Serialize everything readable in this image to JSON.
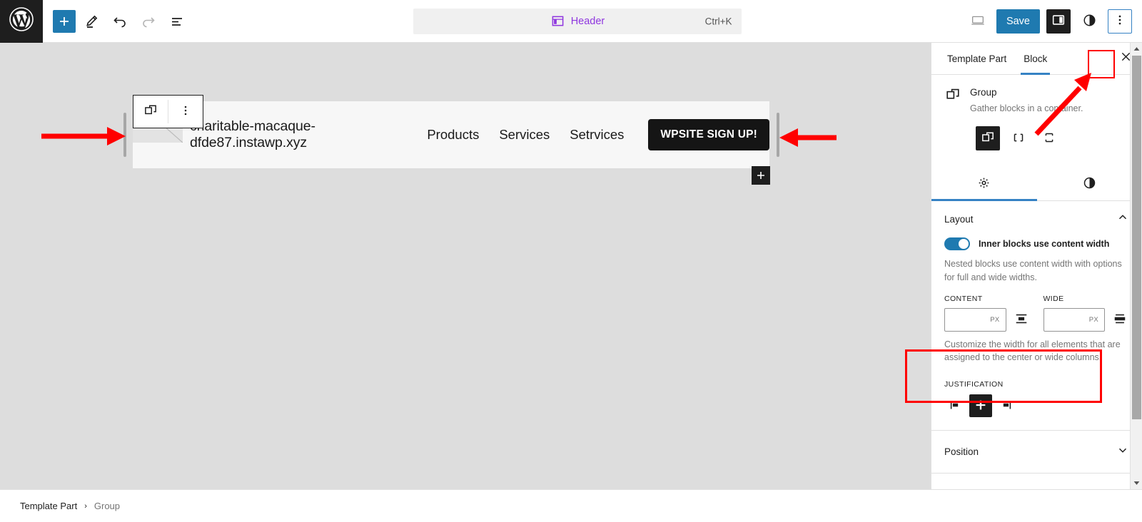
{
  "topbar": {
    "logo_icon": "wordpress-logo",
    "tools": [
      {
        "name": "add-block-button",
        "icon": "plus-icon",
        "label": "Add block"
      },
      {
        "name": "edit-tool-button",
        "icon": "pencil-icon",
        "label": "Tools"
      },
      {
        "name": "undo-button",
        "icon": "undo-icon",
        "label": "Undo"
      },
      {
        "name": "redo-button",
        "icon": "redo-icon",
        "label": "Redo"
      },
      {
        "name": "list-view-button",
        "icon": "list-view-icon",
        "label": "Document Overview"
      }
    ],
    "document_bar": {
      "icon": "template-part-icon",
      "title": "Header",
      "shortcut": "Ctrl+K"
    },
    "preview_label": "View",
    "save_label": "Save",
    "settings_toggle_label": "Settings",
    "styles_toggle_label": "Styles",
    "more_menu_label": "Options"
  },
  "canvas": {
    "block_toolbar": {
      "block_icon": "group-icon",
      "options_icon": "more-vertical-icon"
    },
    "site_logo_alt": "site-logo-placeholder",
    "site_title": "charitable-macaque-dfde87.instawp.xyz",
    "nav_links": [
      "Products",
      "Services",
      "Setrvices"
    ],
    "cta_label": "WPSITE SIGN UP!",
    "appender_label": "+"
  },
  "sidebar": {
    "tabs": [
      {
        "label": "Template Part",
        "active": false
      },
      {
        "label": "Block",
        "active": true
      }
    ],
    "close_label": "✕",
    "block": {
      "icon": "group-icon",
      "title": "Group",
      "description": "Gather blocks in a container."
    },
    "variations": [
      {
        "name": "variation-group",
        "icon": "group-icon",
        "active": true
      },
      {
        "name": "variation-row",
        "icon": "row-icon",
        "active": false
      },
      {
        "name": "variation-stack",
        "icon": "stack-icon",
        "active": false
      }
    ],
    "panel_tabs": [
      {
        "name": "settings-tab",
        "icon": "gear-icon",
        "active": true
      },
      {
        "name": "styles-tab",
        "icon": "contrast-icon",
        "active": false
      }
    ],
    "layout_panel": {
      "title": "Layout",
      "collapse_icon": "chevron-up-icon",
      "toggle_label": "Inner blocks use content width",
      "toggle_on": true,
      "help_text": "Nested blocks use content width with options for full and wide widths.",
      "content_label": "CONTENT",
      "content_value": "",
      "content_unit": "PX",
      "wide_label": "WIDE",
      "wide_value": "",
      "wide_unit": "PX",
      "width_help_text": "Customize the width for all elements that are assigned to the center or wide columns.",
      "justification_label": "JUSTIFICATION",
      "justification_options": [
        {
          "name": "justify-left-button",
          "active": false
        },
        {
          "name": "justify-center-button",
          "active": true
        },
        {
          "name": "justify-right-button",
          "active": false
        }
      ]
    },
    "position_panel": {
      "title": "Position",
      "expand_icon": "chevron-down-icon"
    }
  },
  "breadcrumb": {
    "items": [
      "Template Part",
      "Group"
    ],
    "separator": "›"
  },
  "colors": {
    "accent_blue": "#1f7ab0",
    "tab_blue": "#3582c4",
    "purple": "#8f37df",
    "annotation_red": "#ff0000",
    "dark": "#1e1e1e"
  }
}
